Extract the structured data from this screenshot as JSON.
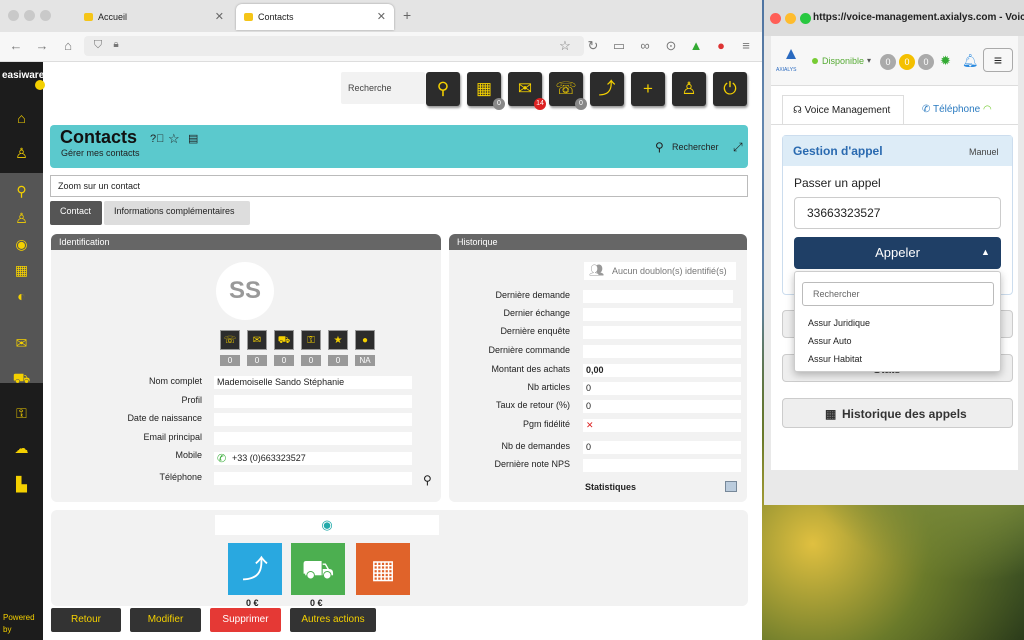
{
  "browser": {
    "tabs": [
      {
        "label": "Accueil"
      },
      {
        "label": "Contacts"
      }
    ],
    "new_tab": "+"
  },
  "sidebar": {
    "logo": "easiware",
    "powered": "Powered",
    "by": "by"
  },
  "toolbar": {
    "search_placeholder": "Recherche",
    "calendar_badge": "0",
    "mail_badge": "14",
    "chat_badge": "0"
  },
  "header": {
    "title": "Contacts",
    "subtitle": "Gérer mes contacts",
    "search_label": "Rechercher"
  },
  "zoom": {
    "label": "Zoom sur un contact"
  },
  "tabs": [
    {
      "label": "Contact"
    },
    {
      "label": "Informations complémentaires"
    }
  ],
  "identification": {
    "title": "Identification",
    "initials": "SS",
    "counters": [
      "0",
      "0",
      "0",
      "0",
      "0",
      "NA"
    ],
    "fields": [
      {
        "label": "Nom complet",
        "value": "Mademoiselle Sando Stéphanie"
      },
      {
        "label": "Profil",
        "value": ""
      },
      {
        "label": "Date de naissance",
        "value": ""
      },
      {
        "label": "Email principal",
        "value": ""
      },
      {
        "label": "Mobile",
        "value": "+33 (0)663323527"
      },
      {
        "label": "Téléphone",
        "value": ""
      }
    ]
  },
  "historique": {
    "title": "Historique",
    "doublon": "Aucun doublon(s) identifié(s)",
    "rows": [
      {
        "label": "Dernière demande",
        "value": ""
      },
      {
        "label": "Dernier échange",
        "value": ""
      },
      {
        "label": "Dernière enquête",
        "value": ""
      },
      {
        "label": "Dernière commande",
        "value": ""
      },
      {
        "label": "Montant des achats",
        "value": "0,00"
      },
      {
        "label": "Nb articles",
        "value": "0"
      },
      {
        "label": "Taux de retour (%)",
        "value": "0"
      },
      {
        "label": "Pgm fidélité",
        "value": "✕"
      },
      {
        "label": "Nb de demandes",
        "value": "0"
      },
      {
        "label": "Dernière note NPS",
        "value": ""
      }
    ],
    "stats": "Statistiques"
  },
  "kpi": {
    "v1": "0 €",
    "v2": "0 €"
  },
  "actions": {
    "retour": "Retour",
    "modifier": "Modifier",
    "supprimer": "Supprimer",
    "autres": "Autres actions"
  },
  "popup": {
    "url": "https://voice-management.axialys.com - Voic...",
    "brand": "AXIALYS",
    "status": "Disponible",
    "counts": [
      "0",
      "0",
      "0"
    ],
    "tab_voice": "Voice Management",
    "tab_phone": "Téléphone",
    "section": "Gestion d'appel",
    "mode": "Manuel",
    "call_label": "Passer un appel",
    "phone": "33663323527",
    "call_button": "Appeler",
    "dropdown_placeholder": "Rechercher",
    "options": [
      "Assur Juridique",
      "Assur Auto",
      "Assur Habitat"
    ],
    "stats_label": "Stats",
    "history": "Historique des appels"
  }
}
